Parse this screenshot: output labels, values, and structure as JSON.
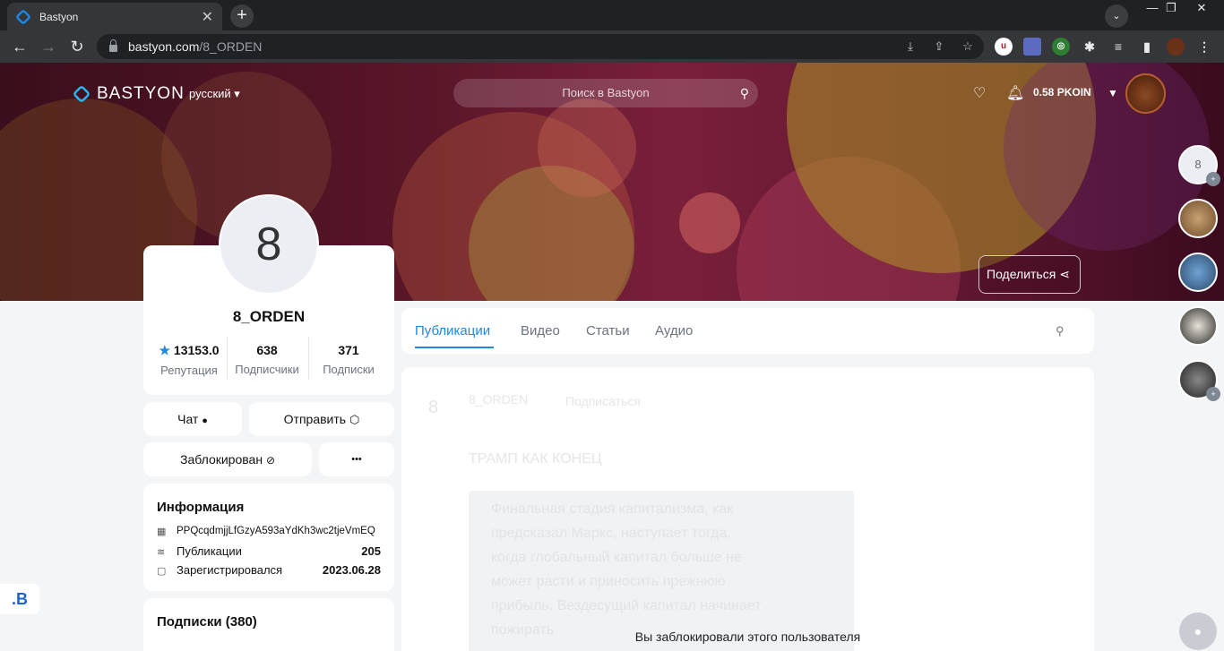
{
  "browser": {
    "tab_title": "Bastyon",
    "tab_close": "✕",
    "new_tab": "+",
    "url_host": "bastyon.com",
    "url_path": "/8_ORDEN"
  },
  "header": {
    "logo_text": "BASTYON",
    "language": "русский",
    "search_placeholder": "Поиск в Bastyon",
    "balance": "0.58 PKOIN"
  },
  "banner": {
    "share_label": "Поделиться"
  },
  "profile": {
    "avatar_letter": "8",
    "username": "8_ORDEN",
    "stats": [
      {
        "value": "13153.0",
        "label": "Репутация"
      },
      {
        "value": "638",
        "label": "Подписчики"
      },
      {
        "value": "371",
        "label": "Подписки"
      }
    ]
  },
  "actions": {
    "chat": "Чат",
    "send": "Отправить",
    "blocked": "Заблокирован",
    "more": "•••"
  },
  "info": {
    "title": "Информация",
    "address": "PPQcqdmjjLfGzyA593aYdKh3wc2tjeVmEQ",
    "publications_label": "Публикации",
    "publications_value": "205",
    "registered_label": "Зарегистрировался",
    "registered_value": "2023.06.28"
  },
  "subscriptions": {
    "title": "Подписки (380)"
  },
  "tabs": [
    {
      "label": "Публикации",
      "active": true
    },
    {
      "label": "Видео",
      "active": false
    },
    {
      "label": "Статьи",
      "active": false
    },
    {
      "label": "Аудио",
      "active": false
    }
  ],
  "post_faded": {
    "author": "8_ORDEN",
    "subscribe": "Подписаться",
    "title": "ТРАМП КАК КОНЕЦ",
    "lines": [
      "Финальная стадия капитализма, как",
      "предсказал Маркс, наступает тогда,",
      "когда глобальный капитал больше не",
      "может расти и приносить прежнюю",
      "прибыль. Вездесущий капитал начинает",
      "пожирать"
    ]
  },
  "blocked_message": "Вы заблокировали этого пользователя",
  "rail": {
    "first_letter": "8"
  },
  "colors": {
    "accent": "#1e88e5",
    "banner": "#5a1628",
    "page_bg": "#f4f5f7"
  }
}
